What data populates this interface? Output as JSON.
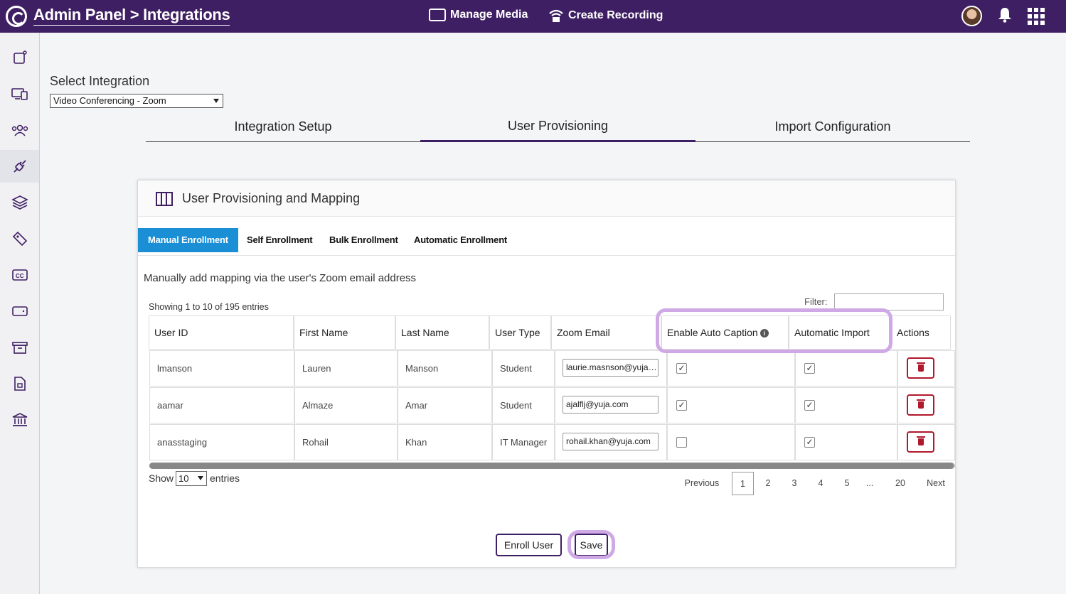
{
  "header": {
    "title": "Admin Panel > Integrations",
    "manage_media": "Manage Media",
    "create_recording": "Create Recording"
  },
  "sidebar": {
    "items": [
      "dashboard-icon",
      "devices-icon",
      "users-icon",
      "integrations-icon",
      "layers-icon",
      "tag-icon",
      "captions-icon",
      "card-icon",
      "archive-icon",
      "document-icon",
      "institution-icon"
    ],
    "active_index": 3
  },
  "integration": {
    "label": "Select Integration",
    "selected": "Video Conferencing - Zoom"
  },
  "tabs": [
    "Integration Setup",
    "User Provisioning",
    "Import Configuration"
  ],
  "active_tab": "User Provisioning",
  "card": {
    "title": "User Provisioning and Mapping",
    "subtabs": [
      "Manual Enrollment",
      "Self Enrollment",
      "Bulk Enrollment",
      "Automatic Enrollment"
    ],
    "active_subtab": "Manual Enrollment",
    "description": "Manually add mapping via the user's Zoom email address",
    "filter_label": "Filter:",
    "showing": "Showing 1 to 10 of 195 entries"
  },
  "table": {
    "headers": [
      "User ID",
      "First Name",
      "Last Name",
      "User Type",
      "Zoom Email",
      "Enable Auto Caption",
      "Automatic Import",
      "Actions"
    ],
    "rows": [
      {
        "user_id": "lmanson",
        "first": "Lauren",
        "last": "Manson",
        "type": "Student",
        "email": "laurie.masnson@yuja.com",
        "caption": true,
        "import": true
      },
      {
        "user_id": "aamar",
        "first": "Almaze",
        "last": "Amar",
        "type": "Student",
        "email": "ajalflj@yuja.com",
        "caption": true,
        "import": true
      },
      {
        "user_id": "anasstaging",
        "first": "Rohail",
        "last": "Khan",
        "type": "IT Manager",
        "email": "rohail.khan@yuja.com",
        "caption": false,
        "import": true
      }
    ]
  },
  "footer": {
    "show": "Show",
    "page_size": "10",
    "entries": "entries",
    "pagination": [
      "Previous",
      "1",
      "2",
      "3",
      "4",
      "5",
      "...",
      "20",
      "Next"
    ],
    "current_page": "1"
  },
  "buttons": {
    "enroll": "Enroll User",
    "save": "Save"
  },
  "colors": {
    "header_bg": "#3f1f63",
    "active_subtab": "#1a8fd6",
    "highlight": "#cfa9e6",
    "delete": "#b0182c"
  }
}
